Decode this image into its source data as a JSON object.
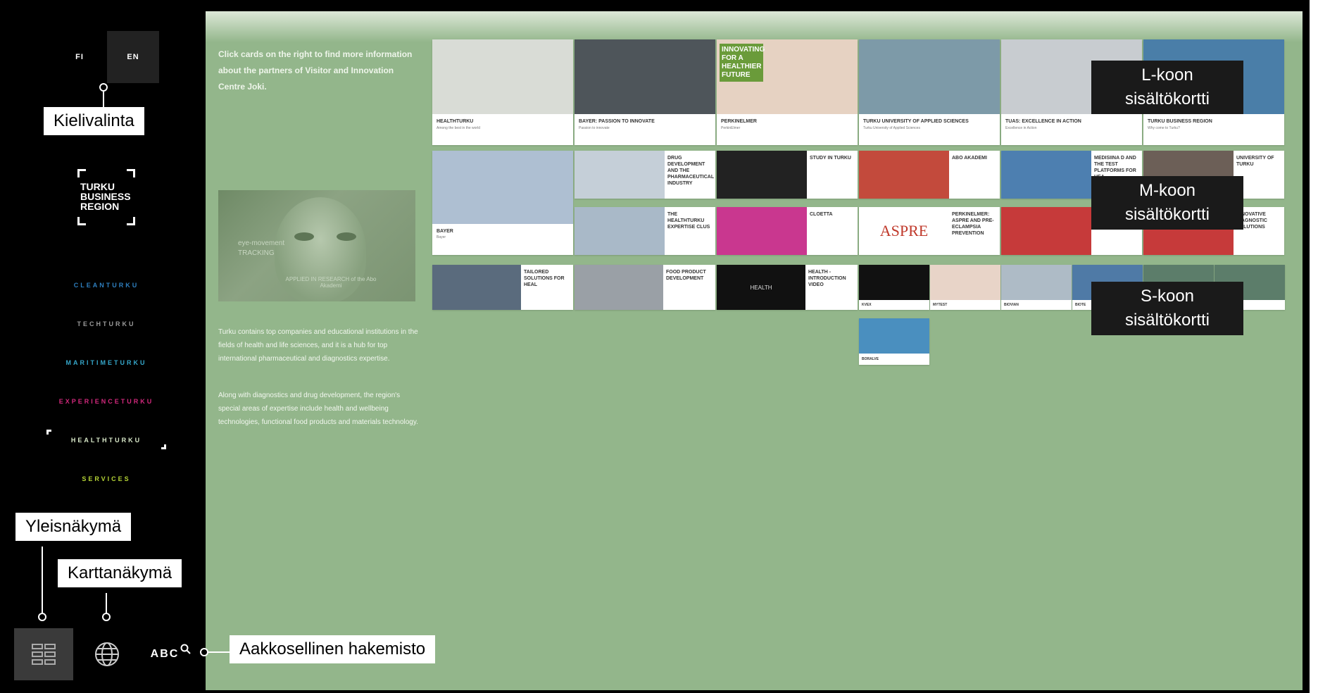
{
  "sidebar": {
    "lang_fi": "FI",
    "lang_en": "EN",
    "logo_text": "TURKU\nBUSINESS\nREGION",
    "brands": [
      {
        "label": "CLEANTURKU",
        "color": "#2e7fbf"
      },
      {
        "label": "TECHTURKU",
        "color": "#9a9a9a"
      },
      {
        "label": "MARITIMETURKU",
        "color": "#35a6c9"
      },
      {
        "label": "EXPERIENCETURKU",
        "color": "#d1287c"
      },
      {
        "label": "HEALTHTURKU",
        "color": "#d8e8c8"
      },
      {
        "label": "SERVICES",
        "color": "#b5d435"
      }
    ],
    "abc_label": "ABC"
  },
  "main": {
    "intro": "Click cards on the right to find more information about the partners of Visitor and Innovation Centre Joki.",
    "video_caption_1": "eye-movement",
    "video_caption_2": "TRACKING",
    "video_caption_3": "APPLIED IN RESEARCH of the Abo Akademi",
    "para1": "Turku contains top companies and educational institutions in the fields of health and life sciences, and it is a hub for top international pharmaceutical and diagnostics expertise.",
    "para2": "Along with diagnostics and drug development, the region's special areas of expertise include health and wellbeing technologies, functional food products and materials technology."
  },
  "cards_L": [
    {
      "title": "HEALTHTURKU",
      "sub": "Among the best in the world",
      "color": "#d9dcd6"
    },
    {
      "title": "BAYER: PASSION TO INNOVATE",
      "sub": "Passion to innovate",
      "color": "#4e555a"
    },
    {
      "title": "PERKINELMER",
      "sub": "PerkinElmer",
      "color": "#e6d2c2",
      "badge": "INNOVATING FOR A HEALTHIER FUTURE"
    },
    {
      "title": "TURKU UNIVERSITY OF APPLIED SCIENCES",
      "sub": "Turku University of Applied Sciences",
      "color": "#7d9aa8"
    },
    {
      "title": "TUAS: EXCELLENCE IN ACTION",
      "sub": "Excellence in Action",
      "color": "#c8ccd0"
    },
    {
      "title": "TURKU BUSINESS REGION",
      "sub": "Why come to Turku?",
      "color": "#4a7ea8"
    }
  ],
  "cards_M": [
    {
      "title": "BAYER",
      "sub": "Bayer",
      "color": "#aebfd2",
      "tall": true
    },
    {
      "title": "DRUG DEVELOPMENT AND THE PHARMACEUTICAL INDUSTRY",
      "color": "#c5cfd8"
    },
    {
      "title": "STUDY IN TURKU",
      "color": "#222222"
    },
    {
      "title": "ABO AKADEMI",
      "color": "#c34a3c"
    },
    {
      "title": "MEDISIINA D AND THE TEST PLATFORMS FOR HEA",
      "color": "#4d7fb0"
    },
    {
      "title": "UNIVERSITY OF TURKU",
      "color": "#6c5f57"
    },
    {
      "title": "THE HEALTHTURKU EXPERTISE CLUS",
      "color": "#a9b9c8"
    },
    {
      "title": "CLOETTA",
      "color": "#c9378f"
    },
    {
      "title": "PERKINELMER: ASPRE AND PRE-ECLAMPSIA PREVENTION",
      "color": "#ffffff",
      "logo": "ASPRE"
    },
    {
      "title": "INNOVATIVE DIAGNOSTIC SOLUTIONS",
      "color": "#c63a3a"
    }
  ],
  "cards_S": [
    {
      "title": "TAILORED SOLUTIONS FOR HEAL",
      "color": "#5a6b7d"
    },
    {
      "title": "FOOD PRODUCT DEVELOPMENT",
      "color": "#9aa0a6"
    },
    {
      "title": "HEALTH - INTRODUCTION VIDEO",
      "color": "#111111",
      "logo": "HEALTH"
    },
    {
      "title": "",
      "label": "KVEX",
      "color": "#111111"
    },
    {
      "title": "",
      "label": "MYTEST",
      "color": "#e8d4c8"
    },
    {
      "title": "",
      "label": "BIOVIAN",
      "color": "#aebbc6"
    },
    {
      "title": "",
      "label": "BIOTE",
      "color": "#4f7aa6"
    },
    {
      "title": "",
      "label": "",
      "color": "#5c7d6a"
    },
    {
      "title": "",
      "label": "BORALVE",
      "color": "#4a8fbf"
    }
  ],
  "callouts": {
    "kielivalinta": "Kielivalinta",
    "yleisnakyma": "Yleisnäkymä",
    "karttanakyma": "Karttanäkymä",
    "aakkosellinen": "Aakkosellinen hakemisto",
    "l_koon_1": "L-koon",
    "l_koon_2": "sisältökortti",
    "m_koon_1": "M-koon",
    "m_koon_2": "sisältökortti",
    "s_koon_1": "S-koon",
    "s_koon_2": "sisältökortti"
  },
  "icons": [
    "grid-view-icon",
    "globe-icon",
    "search-icon"
  ]
}
